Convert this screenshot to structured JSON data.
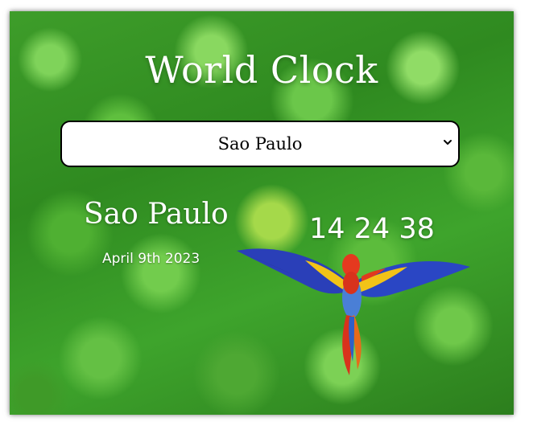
{
  "app": {
    "title": "World Clock"
  },
  "city_select": {
    "selected": "Sao Paulo"
  },
  "city": {
    "name": "Sao Paulo",
    "date": "April 9th 2023",
    "time": "14 24 38"
  },
  "colors": {
    "text": "#ffffff",
    "select_border": "#000000",
    "canopy_green": "#3e9d2a"
  },
  "icons": {
    "dropdown": "chevron-down-icon",
    "background_bird": "parrot-illustration"
  }
}
